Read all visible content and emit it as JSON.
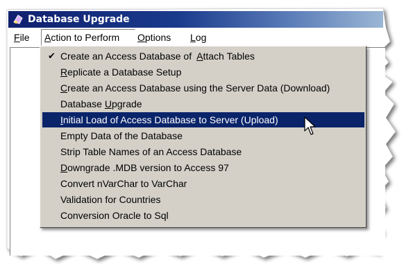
{
  "window": {
    "title": "Database Upgrade"
  },
  "menubar": {
    "items": [
      {
        "label": "File",
        "mnemonic": "F",
        "rest": "ile"
      },
      {
        "label": "Action to Perform",
        "mnemonic": "A",
        "rest": "ction to Perform"
      },
      {
        "label": "Options",
        "mnemonic": "O",
        "rest": "ptions"
      },
      {
        "label": "Log",
        "mnemonic": "L",
        "rest": "og"
      }
    ]
  },
  "dropdown": {
    "items": [
      {
        "pre": "Create an Access Database of  ",
        "mnemonic": "A",
        "post": "ttach Tables",
        "checked": true,
        "check_glyph": "✔"
      },
      {
        "pre": "",
        "mnemonic": "R",
        "post": "eplicate a Database Setup"
      },
      {
        "pre": "",
        "mnemonic": "C",
        "post": "reate an Access Database using the Server Data (Download)"
      },
      {
        "pre": "Database ",
        "mnemonic": "U",
        "post": "pgrade"
      },
      {
        "pre": "",
        "mnemonic": "I",
        "post": "nitial Load of Access Database to Server (Upload)",
        "selected": true
      },
      {
        "pre": "Empty Data of the Database",
        "mnemonic": "",
        "post": ""
      },
      {
        "pre": "Strip Table Names of an Access Database",
        "mnemonic": "",
        "post": ""
      },
      {
        "pre": "",
        "mnemonic": "D",
        "post": "owngrade .MDB version to Access 97"
      },
      {
        "pre": "Convert nVarChar to VarChar",
        "mnemonic": "",
        "post": ""
      },
      {
        "pre": "Validation for Countries",
        "mnemonic": "",
        "post": ""
      },
      {
        "pre": "Conversion Oracle to Sql",
        "mnemonic": "",
        "post": ""
      }
    ]
  },
  "colors": {
    "title_start": "#10206e",
    "title_end": "#9bb6d4",
    "menu_bg": "#d4d0c8",
    "highlight": "#0a246a"
  }
}
